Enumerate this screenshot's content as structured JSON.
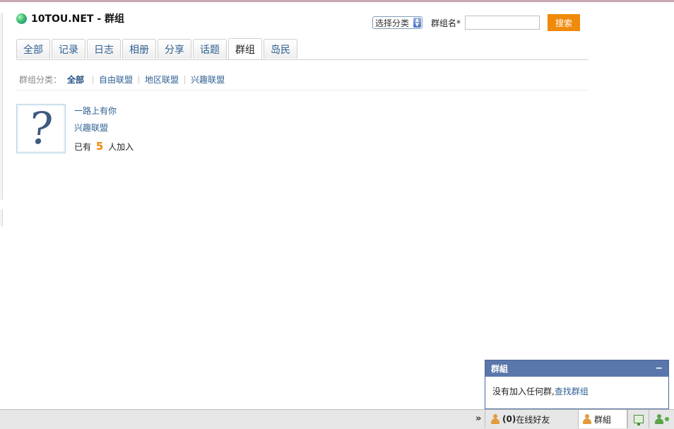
{
  "site": {
    "title": "10TOU.NET - 群组"
  },
  "search": {
    "category_select": "选择分类",
    "group_name_label": "群组名*",
    "query": "",
    "button": "搜索"
  },
  "tabs": [
    {
      "label": "全部"
    },
    {
      "label": "记录"
    },
    {
      "label": "日志"
    },
    {
      "label": "相册"
    },
    {
      "label": "分享"
    },
    {
      "label": "话题"
    },
    {
      "label": "群组",
      "active": true
    },
    {
      "label": "岛民"
    }
  ],
  "categories": {
    "label": "群组分类：",
    "items": [
      "全部",
      "自由联盟",
      "地区联盟",
      "兴趣联盟"
    ]
  },
  "groups": [
    {
      "name": "一路上有你",
      "type": "兴趣联盟",
      "count_prefix": "已有",
      "count": "5",
      "count_suffix": "人加入"
    }
  ],
  "float_panel": {
    "title": "群組",
    "minimize": "−",
    "message": "没有加入任何群,",
    "link": "查找群组"
  },
  "bottom_bar": {
    "expand": "»",
    "online_count": "(0)",
    "online_label": "在线好友",
    "groups_label": "群組"
  }
}
